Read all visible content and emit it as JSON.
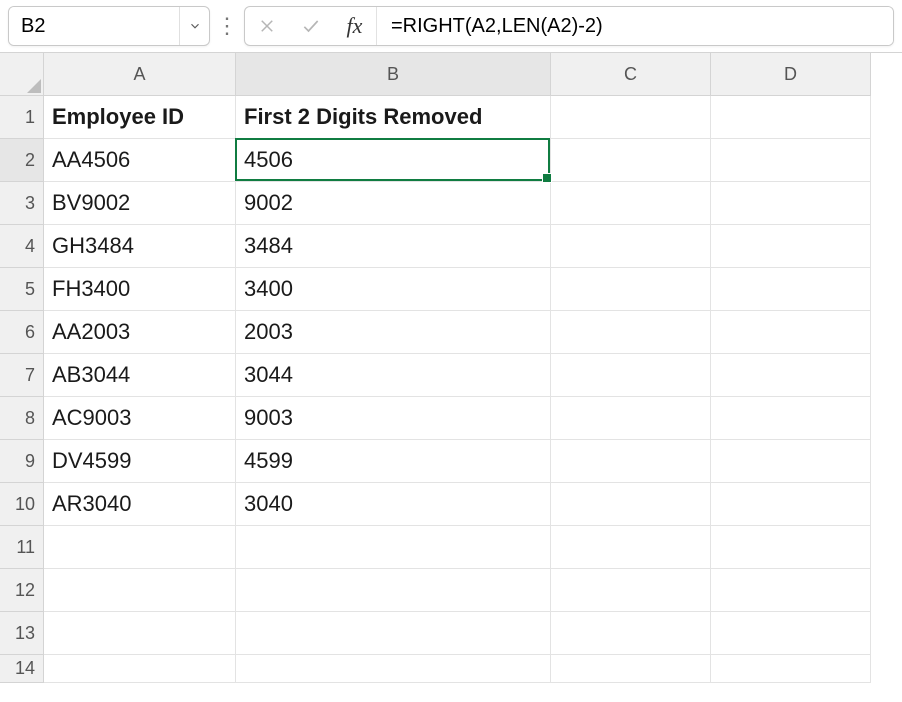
{
  "nameBox": {
    "value": "B2"
  },
  "formulaBar": {
    "cancelIcon": "cancel-icon",
    "enterIcon": "enter-icon",
    "fxLabel": "fx",
    "formula": "=RIGHT(A2,LEN(A2)-2)"
  },
  "columns": [
    "A",
    "B",
    "C",
    "D"
  ],
  "rowsShown": [
    1,
    2,
    3,
    4,
    5,
    6,
    7,
    8,
    9,
    10,
    11,
    12,
    13,
    14
  ],
  "headersRow": {
    "A": "Employee ID",
    "B": "First 2 Digits Removed"
  },
  "dataRows": [
    {
      "A": "AA4506",
      "B": "4506"
    },
    {
      "A": "BV9002",
      "B": "9002"
    },
    {
      "A": "GH3484",
      "B": "3484"
    },
    {
      "A": "FH3400",
      "B": "3400"
    },
    {
      "A": "AA2003",
      "B": "2003"
    },
    {
      "A": "AB3044",
      "B": "3044"
    },
    {
      "A": "AC9003",
      "B": "9003"
    },
    {
      "A": "DV4599",
      "B": "4599"
    },
    {
      "A": "AR3040",
      "B": "3040"
    }
  ],
  "activeCell": {
    "col": "B",
    "row": 2
  }
}
